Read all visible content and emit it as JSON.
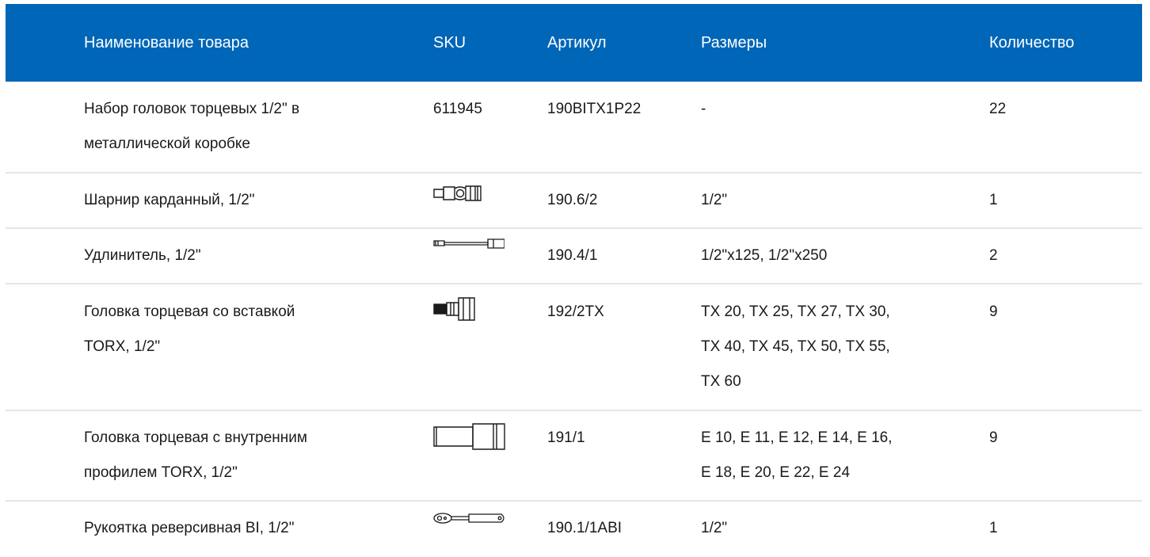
{
  "header": {
    "name": "Наименование товара",
    "sku": "SKU",
    "article": "Артикул",
    "sizes": "Размеры",
    "quantity": "Количество"
  },
  "rows": [
    {
      "name": [
        "Набор головок торцевых 1/2\" в",
        "металлической коробке"
      ],
      "sku": "611945",
      "sku_icon": null,
      "article": "190BITX1P22",
      "sizes": [
        "-"
      ],
      "quantity": "22"
    },
    {
      "name": [
        "Шарнир карданный, 1/2\""
      ],
      "sku": "",
      "sku_icon": "universal-joint-icon",
      "article": "190.6/2",
      "sizes": [
        "1/2\""
      ],
      "quantity": "1"
    },
    {
      "name": [
        "Удлинитель, 1/2\""
      ],
      "sku": "",
      "sku_icon": "extension-bar-icon",
      "article": "190.4/1",
      "sizes": [
        "1/2\"x125, 1/2\"x250"
      ],
      "quantity": "2"
    },
    {
      "name": [
        "Головка торцевая со вставкой",
        "TORX, 1/2\""
      ],
      "sku": "",
      "sku_icon": "torx-bit-socket-icon",
      "article": "192/2TX",
      "sizes": [
        "TX 20, TX 25, TX 27, TX 30,",
        "TX 40, TX 45, TX 50, TX 55,",
        "TX 60"
      ],
      "quantity": "9"
    },
    {
      "name": [
        "Головка торцевая с внутренним",
        "профилем TORX, 1/2\""
      ],
      "sku": "",
      "sku_icon": "socket-icon",
      "article": "191/1",
      "sizes": [
        "E 10, E 11, E 12, E 14, E 16,",
        "E 18, E 20, E 22, E 24"
      ],
      "quantity": "9"
    },
    {
      "name": [
        "Рукоятка реверсивная BI, 1/2\""
      ],
      "sku": "",
      "sku_icon": "ratchet-handle-icon",
      "article": "190.1/1ABI",
      "sizes": [
        "1/2\""
      ],
      "quantity": "1"
    }
  ],
  "colors": {
    "header_bg": "#0066b8",
    "header_text": "#ffffff",
    "divider": "#e6e6e6"
  }
}
